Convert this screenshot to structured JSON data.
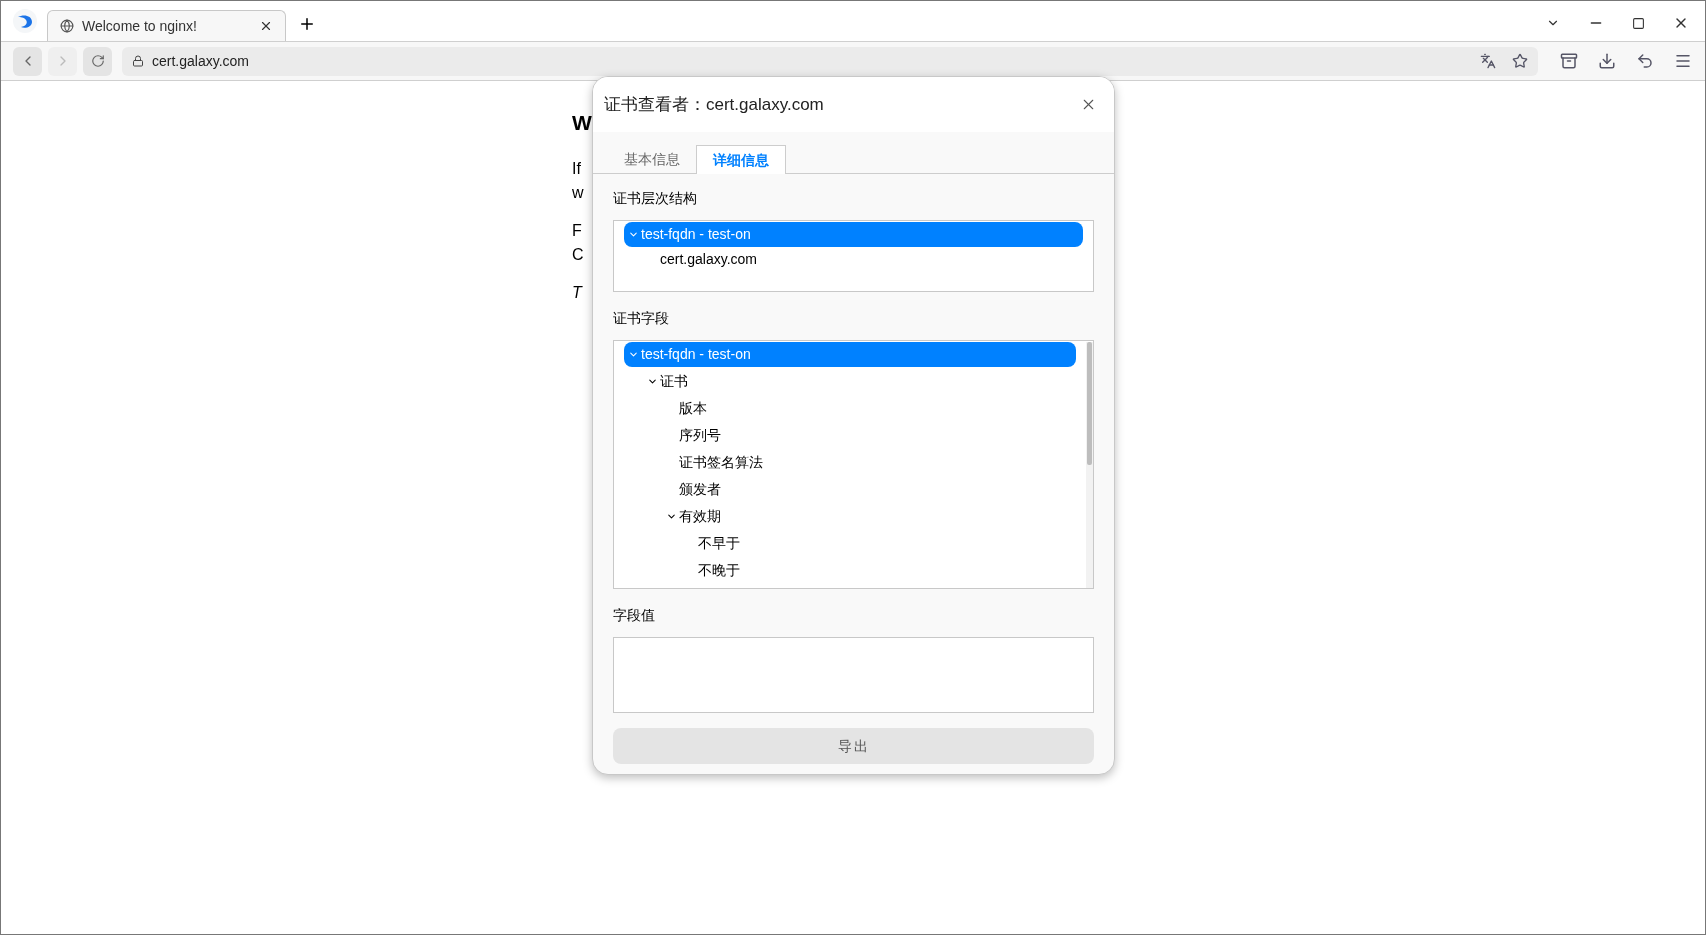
{
  "browser": {
    "tabs": [
      {
        "title": "Welcome to nginx!",
        "selected": true
      }
    ],
    "address": "cert.galaxy.com"
  },
  "page": {
    "heading": "W",
    "paragraphs": [
      {
        "lines": [
          "If",
          "w"
        ],
        "italic": false
      },
      {
        "lines": [
          "F",
          "C"
        ],
        "italic": false
      },
      {
        "lines": [
          "T"
        ],
        "italic": true
      }
    ]
  },
  "dialog": {
    "title": "证书查看者：cert.galaxy.com",
    "tabs": [
      {
        "label": "基本信息",
        "selected": false
      },
      {
        "label": "详细信息",
        "selected": true
      }
    ],
    "hierarchy": {
      "label": "证书层次结构",
      "items": [
        {
          "label": "test-fqdn - test-on",
          "selected": true,
          "expanded": true,
          "children": [
            {
              "label": "cert.galaxy.com",
              "selected": false
            }
          ]
        }
      ]
    },
    "fields": {
      "label": "证书字段",
      "items": [
        {
          "label": "test-fqdn - test-on",
          "selected": true,
          "expanded": true,
          "children": [
            {
              "label": "证书",
              "selected": false,
              "expanded": true,
              "children": [
                {
                  "label": "版本",
                  "selected": false
                },
                {
                  "label": "序列号",
                  "selected": false
                },
                {
                  "label": "证书签名算法",
                  "selected": false
                },
                {
                  "label": "颁发者",
                  "selected": false
                },
                {
                  "label": "有效期",
                  "selected": false,
                  "expanded": true,
                  "children": [
                    {
                      "label": "不早于",
                      "selected": false
                    },
                    {
                      "label": "不晚于",
                      "selected": false
                    }
                  ]
                }
              ]
            }
          ]
        }
      ]
    },
    "field_value": {
      "label": "字段值"
    },
    "export_button": "导出"
  }
}
